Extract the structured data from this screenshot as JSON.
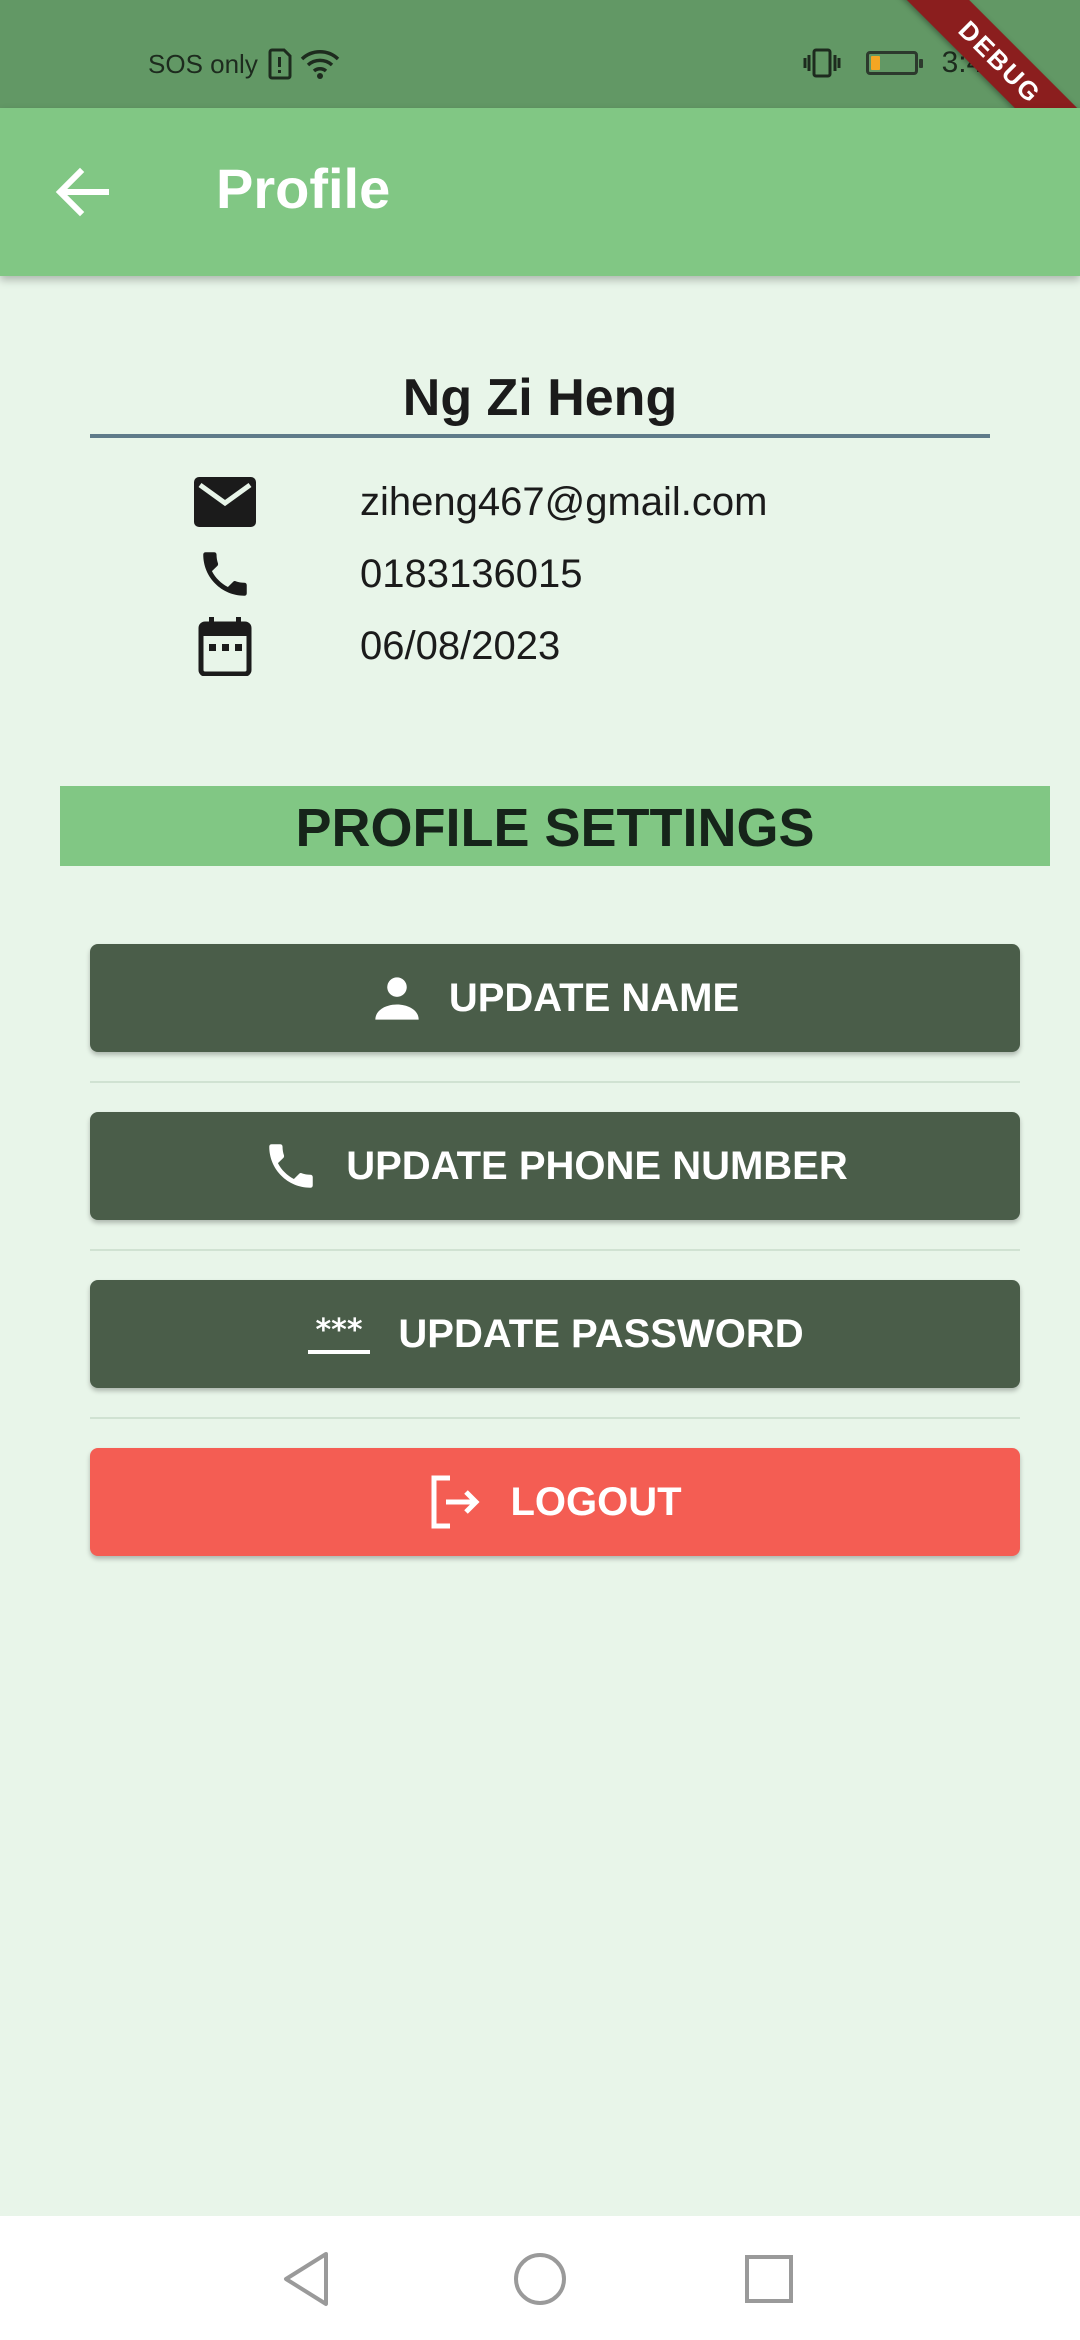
{
  "status_bar": {
    "carrier": "SOS only",
    "time": "3:44",
    "battery_level": 0.2,
    "battery_color": "#f5a623"
  },
  "debug_banner": "DEBUG",
  "app_bar": {
    "back_icon": "arrow-back-icon",
    "title": "Profile"
  },
  "profile": {
    "name": "Ng Zi Heng",
    "email_icon": "mail-icon",
    "email": "ziheng467@gmail.com",
    "phone_icon": "phone-icon",
    "phone": "0183136015",
    "date_icon": "calendar-icon",
    "date": "06/08/2023"
  },
  "settings": {
    "heading": "PROFILE SETTINGS",
    "buttons": [
      {
        "icon": "person-icon",
        "label": "UPDATE NAME"
      },
      {
        "icon": "phone-icon",
        "label": "UPDATE PHONE NUMBER"
      },
      {
        "icon": "password-icon",
        "label": "UPDATE PASSWORD"
      },
      {
        "icon": "logout-icon",
        "label": "LOGOUT"
      }
    ]
  },
  "colors": {
    "background": "#e8f5e9",
    "status_bar": "#629865",
    "app_bar": "#81c784",
    "button": "#4a5d49",
    "logout_button": "#f45d53"
  },
  "nav_bar": [
    "back-triangle-icon",
    "home-circle-icon",
    "recents-square-icon"
  ]
}
